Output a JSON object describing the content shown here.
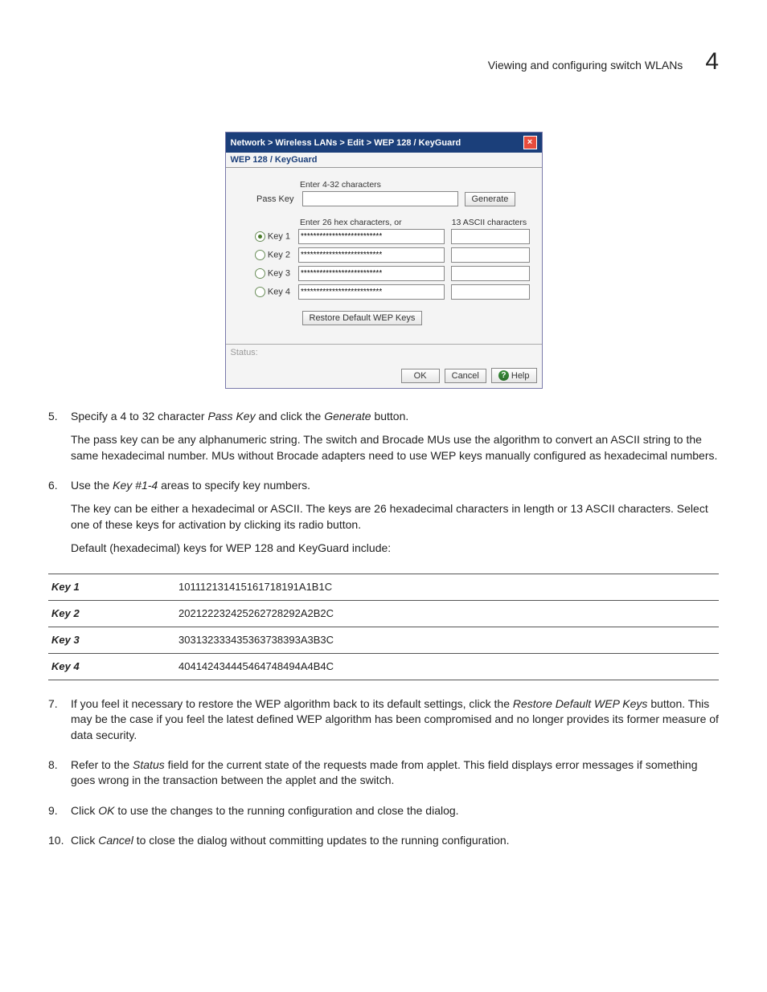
{
  "header": {
    "title": "Viewing and configuring switch WLANs",
    "chapter": "4"
  },
  "dialog": {
    "breadcrumb": "Network > Wireless LANs > Edit > WEP 128 / KeyGuard",
    "subtitle": "WEP 128 / KeyGuard",
    "passkey_label": "Pass Key",
    "passkey_hint": "Enter 4-32 characters",
    "generate_label": "Generate",
    "hex_hint": "Enter 26 hex characters, or",
    "ascii_hint": "13 ASCII characters",
    "keys": [
      {
        "label": "Key 1",
        "hex": "**************************",
        "ascii": "",
        "selected": true
      },
      {
        "label": "Key 2",
        "hex": "**************************",
        "ascii": "",
        "selected": false
      },
      {
        "label": "Key 3",
        "hex": "**************************",
        "ascii": "",
        "selected": false
      },
      {
        "label": "Key 4",
        "hex": "**************************",
        "ascii": "",
        "selected": false
      }
    ],
    "restore_label": "Restore Default WEP Keys",
    "status_label": "Status:",
    "ok_label": "OK",
    "cancel_label": "Cancel",
    "help_label": "Help"
  },
  "steps": {
    "s5": {
      "num": "5.",
      "a": "Specify a 4 to 32 character ",
      "b": "Pass Key",
      "c": " and click the ",
      "d": "Generate",
      "e": " button.",
      "p2": "The pass key can be any alphanumeric string. The switch and Brocade MUs use the algorithm to convert an ASCII string to the same hexadecimal number. MUs without Brocade adapters need to use WEP keys manually configured as hexadecimal numbers."
    },
    "s6": {
      "num": "6.",
      "a": "Use the ",
      "b": "Key #1-4",
      "c": " areas to specify key numbers.",
      "p2": "The key can be either a hexadecimal or ASCII. The keys are 26 hexadecimal characters in length or 13 ASCII characters. Select one of these keys for activation by clicking its radio button.",
      "p3": "Default (hexadecimal) keys for WEP 128 and KeyGuard include:"
    },
    "table": [
      {
        "k": "Key 1",
        "v": "101112131415161718191A1B1C"
      },
      {
        "k": "Key 2",
        "v": "202122232425262728292A2B2C"
      },
      {
        "k": "Key 3",
        "v": "303132333435363738393A3B3C"
      },
      {
        "k": "Key 4",
        "v": "404142434445464748494A4B4C"
      }
    ],
    "s7": {
      "num": "7.",
      "a": "If you feel it necessary to restore the WEP algorithm back to its default settings, click the ",
      "b": "Restore Default WEP Keys",
      "c": " button. This may be the case if you feel the latest defined WEP algorithm has been compromised and no longer provides its former measure of data security."
    },
    "s8": {
      "num": "8.",
      "a": "Refer to the ",
      "b": "Status",
      "c": " field for the current state of the requests made from applet. This field displays error messages if something goes wrong in the transaction between the applet and the switch."
    },
    "s9": {
      "num": "9.",
      "a": "Click ",
      "b": "OK",
      "c": " to use the changes to the running configuration and close the dialog."
    },
    "s10": {
      "num": "10.",
      "a": "Click ",
      "b": "Cancel",
      "c": " to close the dialog without committing updates to the running configuration."
    }
  }
}
